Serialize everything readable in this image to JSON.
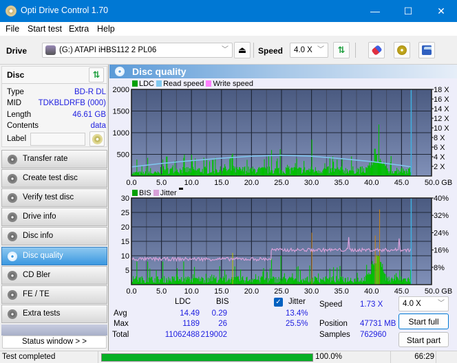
{
  "window": {
    "title": "Opti Drive Control 1.70",
    "minimize": "—",
    "maximize": "☐",
    "close": "✕"
  },
  "menu": [
    "File",
    "Start test",
    "Extra",
    "Help"
  ],
  "toolbar": {
    "drive_label": "Drive",
    "drive_value": "(G:)   ATAPI iHBS112   2 PL06",
    "speed_label": "Speed",
    "speed_value": "4.0 X",
    "eject_icon": "⏏"
  },
  "disc": {
    "header": "Disc",
    "fields": [
      {
        "key": "Type",
        "value": "BD-R DL"
      },
      {
        "key": "MID",
        "value": "TDKBLDRFB (000)"
      },
      {
        "key": "Length",
        "value": "46.61 GB"
      },
      {
        "key": "Contents",
        "value": "data"
      }
    ],
    "label_key": "Label",
    "label_value": ""
  },
  "nav": [
    {
      "label": "Transfer rate",
      "active": false
    },
    {
      "label": "Create test disc",
      "active": false
    },
    {
      "label": "Verify test disc",
      "active": false
    },
    {
      "label": "Drive info",
      "active": false
    },
    {
      "label": "Disc info",
      "active": false
    },
    {
      "label": "Disc quality",
      "active": true
    },
    {
      "label": "CD Bler",
      "active": false
    },
    {
      "label": "FE / TE",
      "active": false
    },
    {
      "label": "Extra tests",
      "active": false
    }
  ],
  "status_window_btn": "Status window > >",
  "panel_title": "Disc quality",
  "colors": {
    "ldc": "#00c000",
    "read_speed": "#80c8f0",
    "write_speed": "#ff80ff",
    "bis": "#00c000",
    "jitter": "#d8a0d8",
    "plot_bg_top": "#4a5a80",
    "plot_bg_bottom": "#8090b8",
    "cursor": "#40b0e0",
    "progress": "#06b025"
  },
  "chart_data": [
    {
      "type": "bar",
      "title": "",
      "legend": [
        "LDC",
        "Read speed",
        "Write speed"
      ],
      "legend_position": "top-left",
      "xlabel": "GB",
      "x_ticks": [
        "0.0",
        "5.0",
        "10.0",
        "15.0",
        "20.0",
        "25.0",
        "30.0",
        "35.0",
        "40.0",
        "45.0",
        "50.0 GB"
      ],
      "xlim": [
        0,
        50
      ],
      "ylim_left": [
        0,
        2000
      ],
      "y_ticks_left": [
        "2000",
        "1500",
        "1000",
        "500"
      ],
      "ylim_right": [
        0,
        18
      ],
      "y_ticks_right": [
        "18 X",
        "16 X",
        "14 X",
        "12 X",
        "10 X",
        "8 X",
        "6 X",
        "4 X",
        "2 X"
      ],
      "grid": true,
      "disc_end_gb": 46.61,
      "read_speed_x": [
        0,
        5,
        10,
        15,
        20,
        25,
        30,
        35,
        40,
        45,
        46.6
      ],
      "read_speed_values": [
        1.9,
        2.6,
        3.2,
        3.7,
        4.1,
        4.3,
        4.1,
        3.6,
        3.0,
        2.2,
        1.9
      ],
      "ldc_peaks": [
        {
          "x": 0.8,
          "y": 380
        },
        {
          "x": 2.6,
          "y": 420
        },
        {
          "x": 5.2,
          "y": 380
        },
        {
          "x": 8.6,
          "y": 420
        },
        {
          "x": 13.5,
          "y": 370
        },
        {
          "x": 16.8,
          "y": 520
        },
        {
          "x": 23.3,
          "y": 600
        },
        {
          "x": 24.7,
          "y": 620
        },
        {
          "x": 30.0,
          "y": 840
        },
        {
          "x": 33.5,
          "y": 450
        },
        {
          "x": 40.5,
          "y": 630
        },
        {
          "x": 41.2,
          "y": 1189
        }
      ],
      "ldc_baseline": 150
    },
    {
      "type": "bar",
      "title": "",
      "legend": [
        "BIS",
        "Jitter"
      ],
      "legend_position": "top-left",
      "xlabel": "GB",
      "x_ticks": [
        "0.0",
        "5.0",
        "10.0",
        "15.0",
        "20.0",
        "25.0",
        "30.0",
        "35.0",
        "40.0",
        "45.0",
        "50.0 GB"
      ],
      "xlim": [
        0,
        50
      ],
      "ylim_left": [
        0,
        30
      ],
      "y_ticks_left": [
        "30",
        "25",
        "20",
        "15",
        "10",
        "5"
      ],
      "ylim_right": [
        0,
        40
      ],
      "y_ticks_right": [
        "40%",
        "32%",
        "24%",
        "16%",
        "8%"
      ],
      "grid": true,
      "disc_end_gb": 46.61,
      "jitter_segments": [
        {
          "from": 0,
          "to": 23.3,
          "value_pct": 11.8
        },
        {
          "from": 23.3,
          "to": 46.6,
          "value_pct": 16.0
        }
      ],
      "bis_peaks": [
        {
          "x": 0.8,
          "y": 8
        },
        {
          "x": 2.6,
          "y": 8
        },
        {
          "x": 5.2,
          "y": 8
        },
        {
          "x": 8.6,
          "y": 8
        },
        {
          "x": 16.8,
          "y": 11
        },
        {
          "x": 23.3,
          "y": 9
        },
        {
          "x": 24.8,
          "y": 10
        },
        {
          "x": 30.0,
          "y": 18
        },
        {
          "x": 40.6,
          "y": 17
        },
        {
          "x": 41.3,
          "y": 26
        }
      ],
      "bis_baseline": 2
    }
  ],
  "stats": {
    "col_ldc": "LDC",
    "col_bis": "BIS",
    "rows": [
      {
        "label": "Avg",
        "ldc": "14.49",
        "bis": "0.29",
        "jitter": "13.4%"
      },
      {
        "label": "Max",
        "ldc": "1189",
        "bis": "26",
        "jitter": "25.5%"
      },
      {
        "label": "Total",
        "ldc": "11062488",
        "bis": "219002",
        "jitter": ""
      }
    ],
    "jitter_label": "Jitter",
    "jitter_checked": true,
    "speed_label": "Speed",
    "speed_value": "1.73 X",
    "position_label": "Position",
    "position_value": "47731 MB",
    "samples_label": "Samples",
    "samples_value": "762960",
    "speed_select": "4.0 X",
    "start_full": "Start full",
    "start_part": "Start part"
  },
  "statusbar": {
    "text": "Test completed",
    "progress_pct": 100.0,
    "progress_text": "100.0%",
    "time": "66:29"
  }
}
